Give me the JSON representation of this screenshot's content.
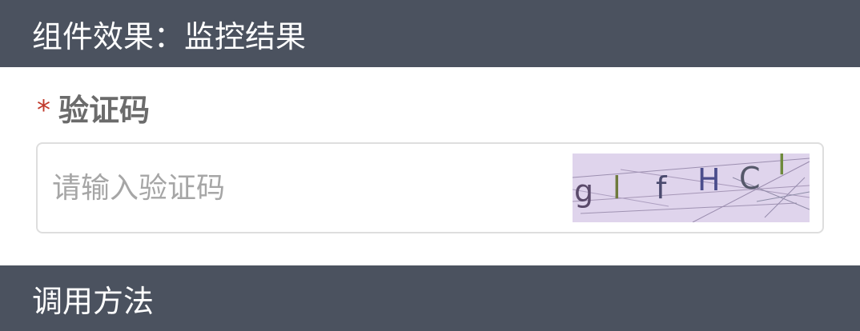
{
  "header": {
    "title": "组件效果：监控结果"
  },
  "form": {
    "required_mark": "*",
    "label": "验证码",
    "placeholder": "请输入验证码",
    "captcha": {
      "characters": [
        "g",
        "l",
        "f",
        "H",
        "C",
        "l"
      ],
      "colors": [
        "#5a4a6a",
        "#6e7a3c",
        "#4a4a6e",
        "#4b4d8c",
        "#55586a",
        "#6e8a3c"
      ],
      "background": "#dfd4ec"
    }
  },
  "section2": {
    "title": "调用方法"
  }
}
